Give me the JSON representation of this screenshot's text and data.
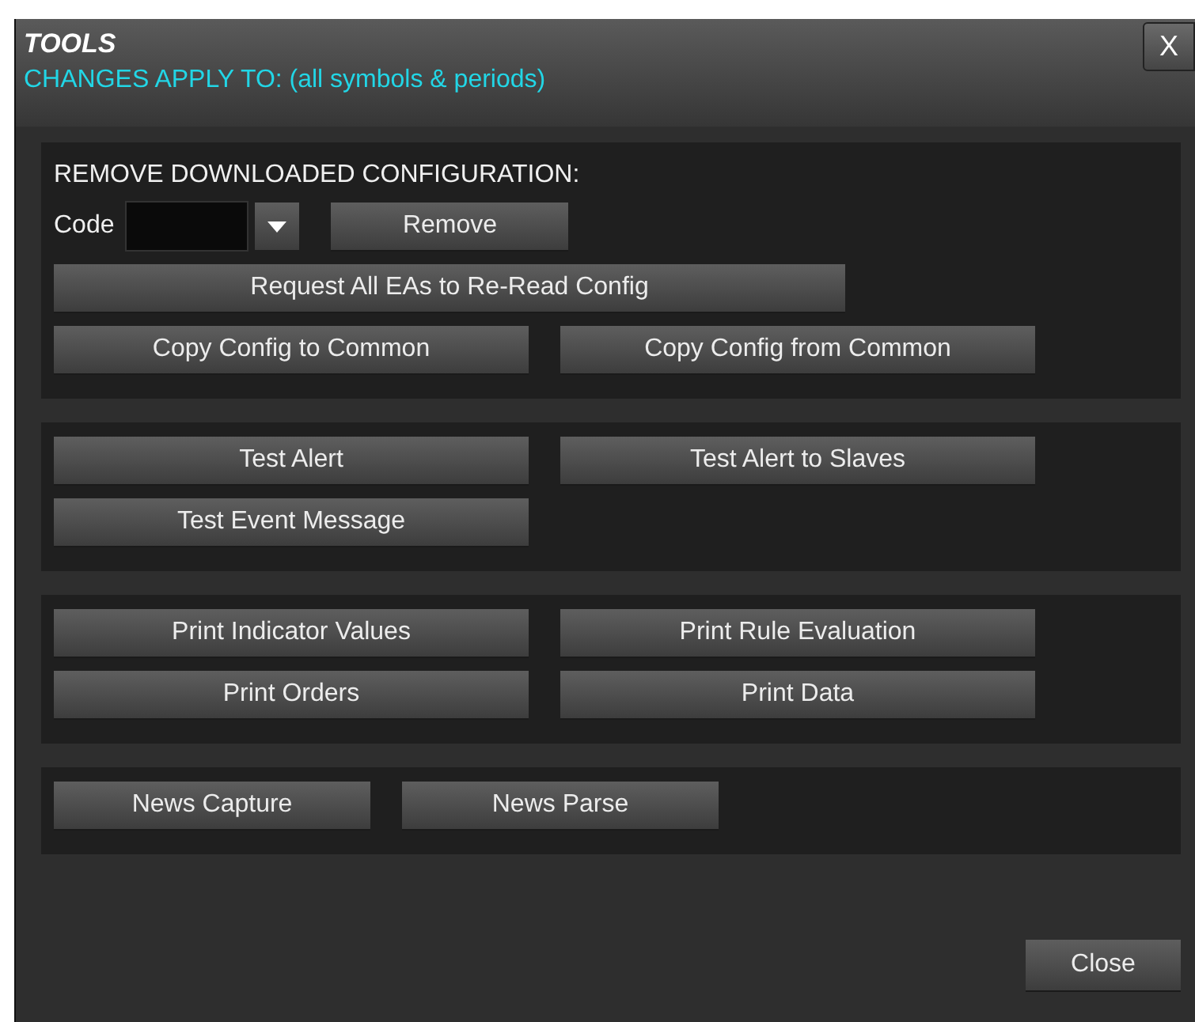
{
  "window": {
    "title": "TOOLS",
    "subtitle": "CHANGES APPLY TO: (all symbols & periods)",
    "close_glyph": "X"
  },
  "sections": [
    {
      "heading": "REMOVE DOWNLOADED CONFIGURATION:",
      "code": {
        "label": "Code",
        "button": "Remove"
      },
      "rows": [
        {
          "kind": "full",
          "buttons": [
            "Request All EAs to Re-Read Config"
          ]
        },
        {
          "kind": "pair",
          "buttons": [
            "Copy Config to Common",
            "Copy Config from Common"
          ]
        }
      ]
    },
    {
      "rows": [
        {
          "kind": "pair",
          "buttons": [
            "Test Alert",
            "Test Alert to Slaves"
          ]
        },
        {
          "kind": "pair",
          "buttons": [
            "Test Event Message"
          ]
        }
      ]
    },
    {
      "rows": [
        {
          "kind": "pair",
          "buttons": [
            "Print Indicator Values",
            "Print Rule Evaluation"
          ]
        },
        {
          "kind": "pair",
          "buttons": [
            "Print Orders",
            "Print Data"
          ]
        }
      ]
    },
    {
      "rows": [
        {
          "kind": "small",
          "buttons": [
            "News Capture",
            "News Parse"
          ]
        }
      ]
    }
  ],
  "footer": {
    "button": "Close"
  }
}
